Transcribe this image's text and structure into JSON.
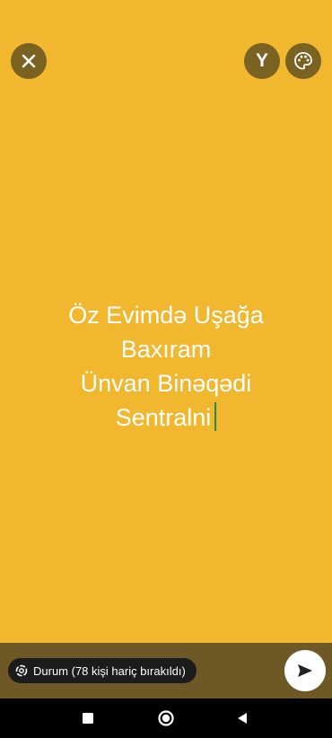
{
  "colors": {
    "background": "#F0B72F",
    "overlay_button": "#7A6322",
    "bottom_bar": "#6E5826",
    "cursor": "#1f8f4e",
    "text": "#FFFFFF"
  },
  "toolbar": {
    "close_icon": "close-icon",
    "font_label": "Y",
    "palette_icon": "palette-icon"
  },
  "status": {
    "lines": [
      "Öz Evimdə Uşağa",
      "Baxıram",
      "Ünvan Binəqədi",
      "Sentralni"
    ]
  },
  "footer": {
    "privacy_label": "Durum (78 kişi hariç bırakıldı)",
    "send_icon": "send-icon"
  },
  "navigation": {
    "buttons": [
      "square-icon",
      "circle-icon",
      "triangle-back-icon"
    ]
  }
}
